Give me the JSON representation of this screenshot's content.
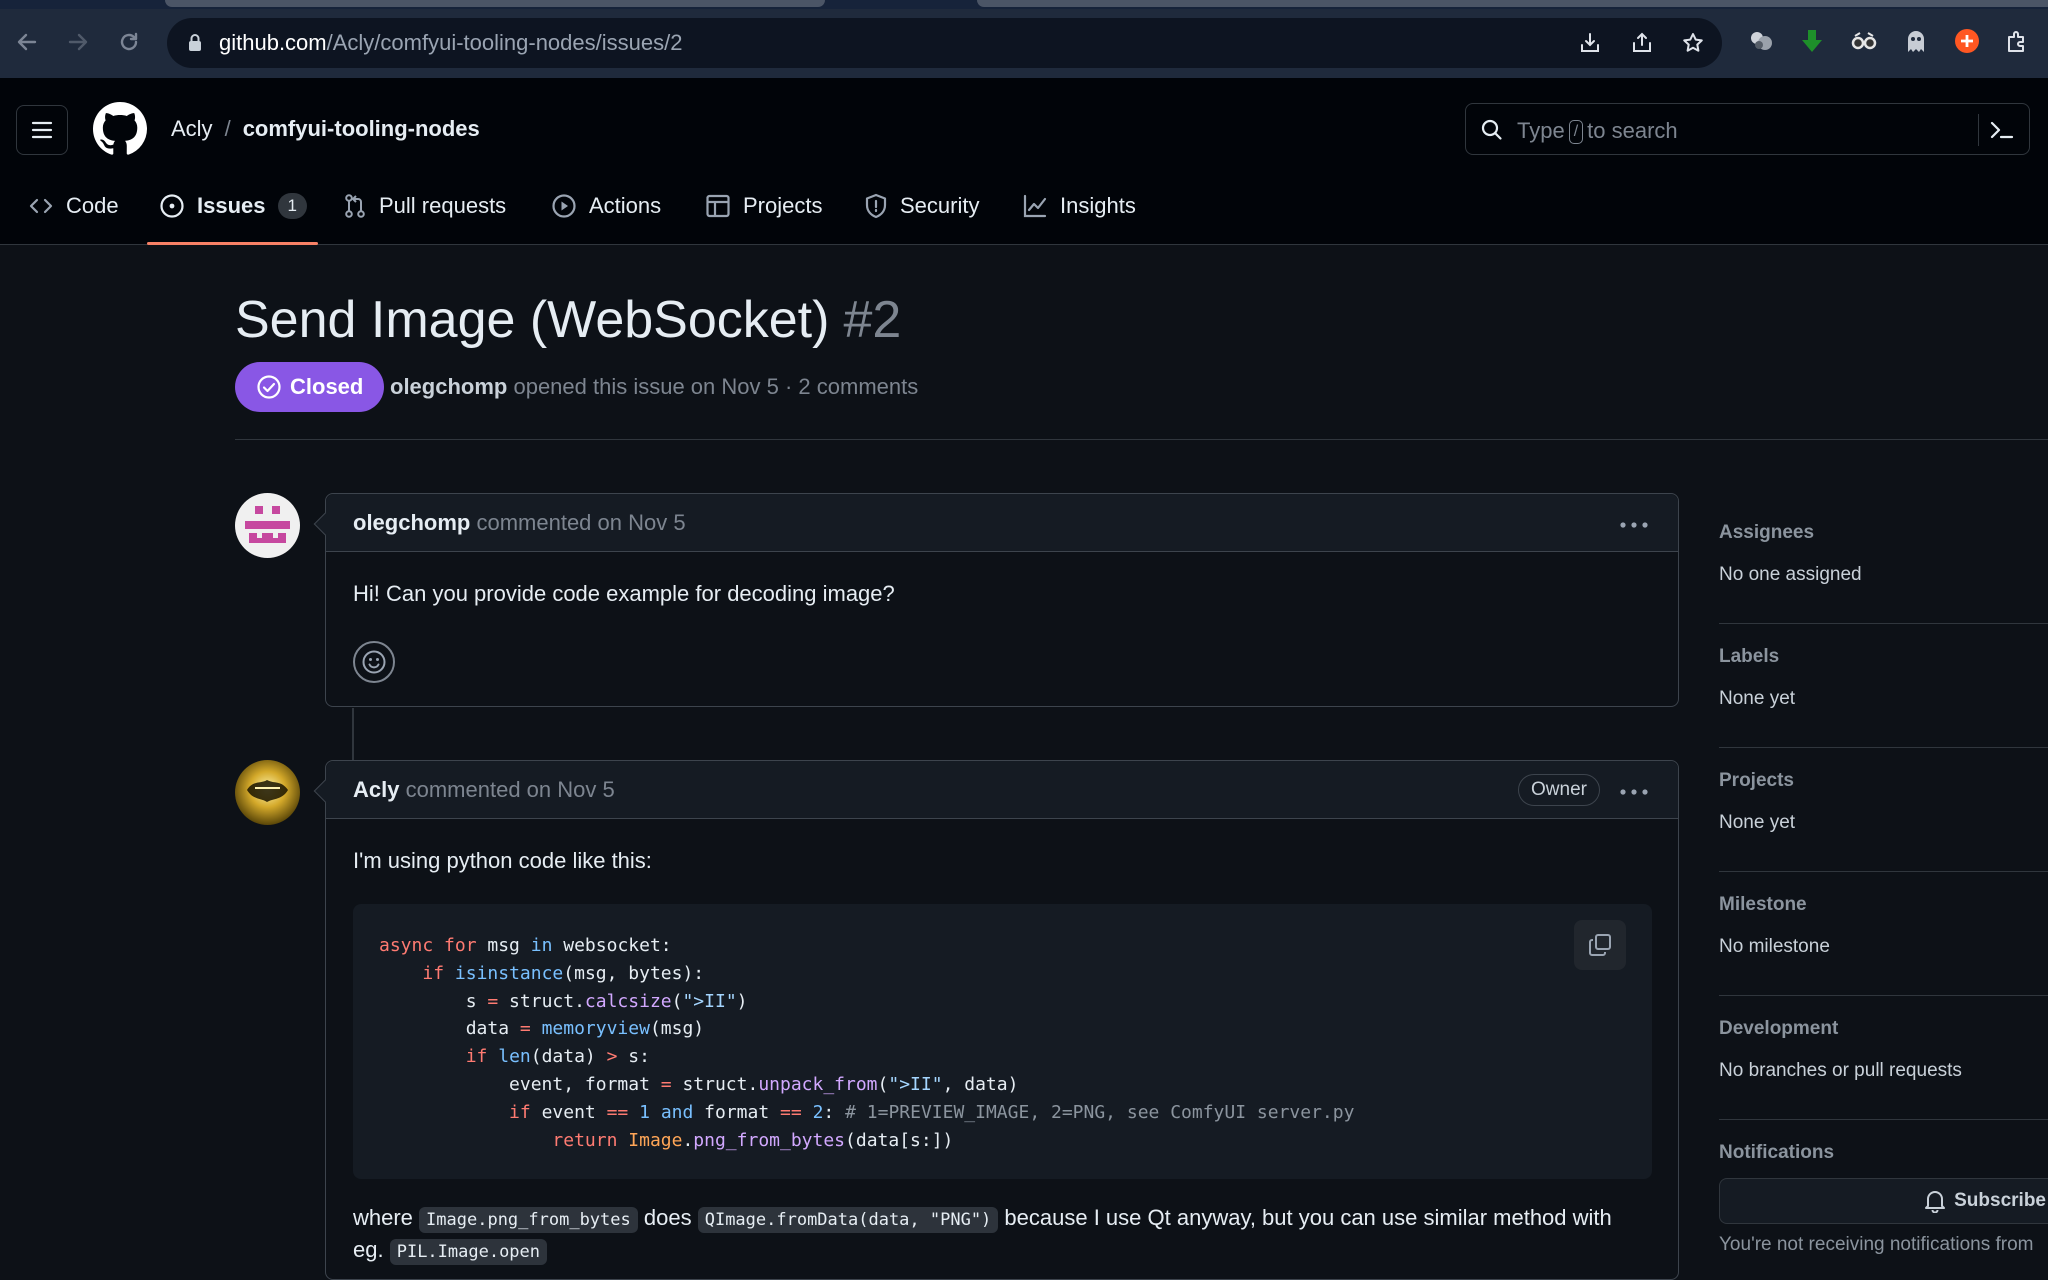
{
  "browser": {
    "url_host": "github.com",
    "url_path": "/Acly/comfyui-tooling-nodes/issues/2"
  },
  "header": {
    "owner": "Acly",
    "separator": "/",
    "repo": "comfyui-tooling-nodes",
    "search_pre": "Type",
    "search_key": "/",
    "search_post": "to search"
  },
  "tabs": [
    {
      "label": "Code",
      "icon": "code-icon"
    },
    {
      "label": "Issues",
      "icon": "issue-opened-icon",
      "count": "1"
    },
    {
      "label": "Pull requests",
      "icon": "git-pull-request-icon"
    },
    {
      "label": "Actions",
      "icon": "play-icon"
    },
    {
      "label": "Projects",
      "icon": "table-icon"
    },
    {
      "label": "Security",
      "icon": "shield-icon"
    },
    {
      "label": "Insights",
      "icon": "graph-icon"
    }
  ],
  "issue": {
    "title": "Send Image (WebSocket)",
    "number": "#2",
    "state": "Closed",
    "author": "olegchomp",
    "meta_rest": "opened this issue on Nov 5 · 2 comments"
  },
  "comments": [
    {
      "author": "olegchomp",
      "action": "commented on Nov 5",
      "body": "Hi! Can you provide code example for decoding image?"
    },
    {
      "author": "Acly",
      "action": "commented on Nov 5",
      "badge": "Owner",
      "intro": "I'm using python code like this:",
      "after_1": "where",
      "code_1": "Image.png_from_bytes",
      "after_2": "does",
      "code_2": "QImage.fromData(data, \"PNG\")",
      "after_3": "because I use Qt anyway, but you can use similar method with",
      "after_4": "eg.",
      "code_3": "PIL.Image.open"
    }
  ],
  "sidebar": [
    {
      "heading": "Assignees",
      "value": "No one assigned"
    },
    {
      "heading": "Labels",
      "value": "None yet"
    },
    {
      "heading": "Projects",
      "value": "None yet"
    },
    {
      "heading": "Milestone",
      "value": "No milestone"
    },
    {
      "heading": "Development",
      "value": "No branches or pull requests"
    },
    {
      "heading": "Notifications",
      "value": ""
    }
  ],
  "notifications": {
    "subscribe_label": "Subscribe",
    "note": "You're not receiving notifications from"
  },
  "colors": {
    "closed": "#8957e5",
    "tab_underline": "#f78166",
    "page_bg": "#0d1117"
  }
}
